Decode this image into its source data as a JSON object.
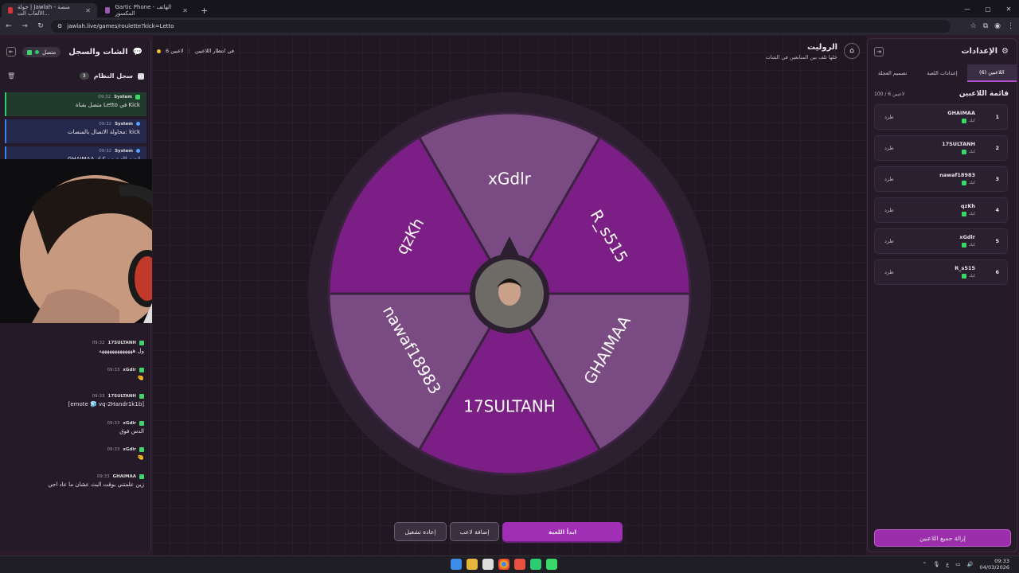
{
  "browser": {
    "tabs": [
      {
        "title": "جولة | Jawlah - منصة الألعاب الت..."
      },
      {
        "title": "Gartic Phone - الهاتف المكسور"
      }
    ],
    "url": "jawlah.live/games/roulette?kick=Letto"
  },
  "left_panel": {
    "title": "الشات والسجل",
    "status": "متصل",
    "system_log_title": "سجل النظام",
    "system_log_count": "3",
    "system_entries": [
      {
        "author": "System",
        "time": "09:32",
        "text": "متصل بقناة Letto في Kick",
        "kind": "success"
      },
      {
        "author": "System",
        "time": "09:32",
        "text": "محاولة الاتصال بالمنصات: kick",
        "kind": "info"
      },
      {
        "author": "System",
        "time": "09:32",
        "text": "GHAIMAA انضم للعبة من كيك",
        "kind": "info"
      }
    ],
    "chat": [
      {
        "user": "17SULTANH",
        "time": "09:32",
        "text": "ول هههههههههههههه"
      },
      {
        "user": "xGdlr",
        "time": "09:33",
        "text": "🤏"
      },
      {
        "user": "17SULTANH",
        "time": "09:33",
        "text": "[emote 🧊 vq-2Handr1k1b]"
      },
      {
        "user": "xGdlr",
        "time": "09:33",
        "text": "الدس فوق"
      },
      {
        "user": "xGdlr",
        "time": "09:33",
        "text": "🤏"
      },
      {
        "user": "GHAIMAA",
        "time": "09:33",
        "text": "زين علمتني بوقت البث عشان ما عاد اجي"
      }
    ]
  },
  "game": {
    "title": "الروليت",
    "subtitle": "خلها تلف بين المتابعين في الشات",
    "players_count": "6 لاعبين",
    "waiting_label": "في انتظار اللاعبين",
    "buttons": {
      "start": "ابدأ اللعبة",
      "add": "إضافة لاعب",
      "restart": "إعادة تشغيل"
    },
    "wheel": {
      "segments": [
        "xGdlr",
        "R_s515",
        "GHAIMAA",
        "17SULTANH",
        "nawaf18983",
        "qzKh"
      ],
      "colors": {
        "dark": "#7b1f86",
        "light": "#7a4a82",
        "ring": "#2c2030"
      }
    }
  },
  "right_panel": {
    "title": "الإعدادات",
    "tabs": [
      "اللاعبين (6)",
      "إعدادات اللعبة",
      "تصميم العجلة"
    ],
    "list_title": "قائمة اللاعبين",
    "list_count": "100 / 6 لاعبين",
    "kick_label": "طرد",
    "platform_label": "كيك",
    "players": [
      {
        "num": "1",
        "name": "GHAIMAA"
      },
      {
        "num": "2",
        "name": "17SULTANH"
      },
      {
        "num": "3",
        "name": "nawaf18983"
      },
      {
        "num": "4",
        "name": "qzKh"
      },
      {
        "num": "5",
        "name": "xGdlr"
      },
      {
        "num": "6",
        "name": "R_s515"
      }
    ],
    "remove_all": "إزالة جميع اللاعبين"
  },
  "taskbar": {
    "time": "09:33",
    "date": "04/03/2026",
    "lang": "ع"
  }
}
